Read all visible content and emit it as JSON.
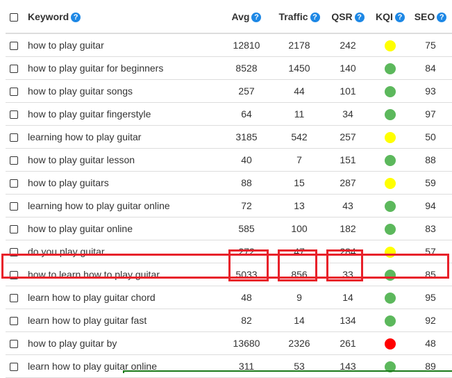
{
  "table": {
    "headers": {
      "keyword": "Keyword",
      "avg": "Avg",
      "traffic": "Traffic",
      "qsr": "QSR",
      "kqi": "KQI",
      "seo": "SEO"
    },
    "help_glyph": "?",
    "kqi_colors": {
      "yellow": "#ffff00",
      "green": "#5cb85c",
      "red": "#ff0000"
    },
    "rows": [
      {
        "keyword": "how to play guitar",
        "avg": "12810",
        "traffic": "2178",
        "qsr": "242",
        "kqi": "yellow",
        "seo": "75"
      },
      {
        "keyword": "how to play guitar for beginners",
        "avg": "8528",
        "traffic": "1450",
        "qsr": "140",
        "kqi": "green",
        "seo": "84"
      },
      {
        "keyword": "how to play guitar songs",
        "avg": "257",
        "traffic": "44",
        "qsr": "101",
        "kqi": "green",
        "seo": "93"
      },
      {
        "keyword": "how to play guitar fingerstyle",
        "avg": "64",
        "traffic": "11",
        "qsr": "34",
        "kqi": "green",
        "seo": "97"
      },
      {
        "keyword": "learning how to play guitar",
        "avg": "3185",
        "traffic": "542",
        "qsr": "257",
        "kqi": "yellow",
        "seo": "50"
      },
      {
        "keyword": "how to play guitar lesson",
        "avg": "40",
        "traffic": "7",
        "qsr": "151",
        "kqi": "green",
        "seo": "88"
      },
      {
        "keyword": "how to play guitars",
        "avg": "88",
        "traffic": "15",
        "qsr": "287",
        "kqi": "yellow",
        "seo": "59"
      },
      {
        "keyword": "learning how to play guitar online",
        "avg": "72",
        "traffic": "13",
        "qsr": "43",
        "kqi": "green",
        "seo": "94"
      },
      {
        "keyword": "how to play guitar online",
        "avg": "585",
        "traffic": "100",
        "qsr": "182",
        "kqi": "green",
        "seo": "83"
      },
      {
        "keyword": "do you play guitar",
        "avg": "272",
        "traffic": "47",
        "qsr": "284",
        "kqi": "yellow",
        "seo": "57"
      },
      {
        "keyword": "how to learn how to play guitar",
        "avg": "5033",
        "traffic": "856",
        "qsr": "33",
        "kqi": "green",
        "seo": "85"
      },
      {
        "keyword": "learn how to play guitar chord",
        "avg": "48",
        "traffic": "9",
        "qsr": "14",
        "kqi": "green",
        "seo": "95"
      },
      {
        "keyword": "learn how to play guitar fast",
        "avg": "82",
        "traffic": "14",
        "qsr": "134",
        "kqi": "green",
        "seo": "92"
      },
      {
        "keyword": "how to play guitar by",
        "avg": "13680",
        "traffic": "2326",
        "qsr": "261",
        "kqi": "red",
        "seo": "48"
      },
      {
        "keyword": "learn how to play guitar online",
        "avg": "311",
        "traffic": "53",
        "qsr": "143",
        "kqi": "green",
        "seo": "89"
      }
    ]
  },
  "annotation": {
    "highlight_color": "#e8202a",
    "highlighted_row": 10
  }
}
